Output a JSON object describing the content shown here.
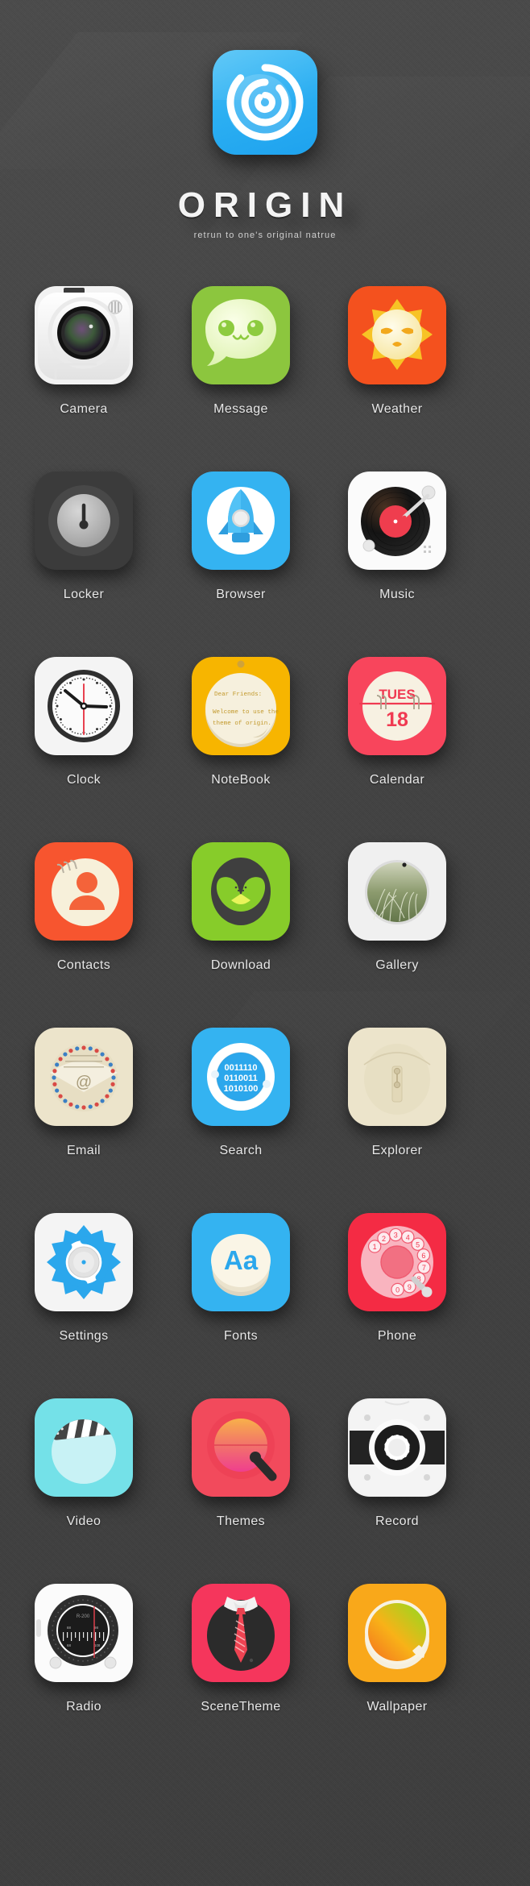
{
  "header": {
    "logo_icon": "origin-spiral-icon",
    "title": "ORIGIN",
    "tagline": "retrun to one's original natrue",
    "brand_color": "#2aaef2"
  },
  "grid": {
    "columns": 3,
    "rows": 8,
    "apps": [
      {
        "label": "Camera",
        "icon": "camera-icon",
        "bg": "#f2f2f2",
        "row": 0,
        "col": 0
      },
      {
        "label": "Message",
        "icon": "message-icon",
        "bg": "#8cc63e",
        "row": 0,
        "col": 1
      },
      {
        "label": "Weather",
        "icon": "weather-sun-icon",
        "bg": "#f4511e",
        "row": 0,
        "col": 2
      },
      {
        "label": "Locker",
        "icon": "locker-icon",
        "bg": "#3b3b3b",
        "row": 1,
        "col": 0
      },
      {
        "label": "Browser",
        "icon": "rocket-icon",
        "bg": "#34b3f1",
        "row": 1,
        "col": 1
      },
      {
        "label": "Music",
        "icon": "turntable-icon",
        "bg": "#fafafa",
        "row": 1,
        "col": 2
      },
      {
        "label": "Clock",
        "icon": "clock-icon",
        "bg": "#f4f4f4",
        "row": 2,
        "col": 0
      },
      {
        "label": "NoteBook",
        "icon": "notebook-icon",
        "bg": "#f7b500",
        "row": 2,
        "col": 1
      },
      {
        "label": "Calendar",
        "icon": "calendar-icon",
        "bg": "#f8455c",
        "row": 2,
        "col": 2
      },
      {
        "label": "Contacts",
        "icon": "contacts-icon",
        "bg": "#f7552f",
        "row": 3,
        "col": 0
      },
      {
        "label": "Download",
        "icon": "download-icon",
        "bg": "#87cc2a",
        "row": 3,
        "col": 1
      },
      {
        "label": "Gallery",
        "icon": "gallery-icon",
        "bg": "#f0f0f0",
        "row": 3,
        "col": 2
      },
      {
        "label": "Email",
        "icon": "airmail-icon",
        "bg": "#ece4cb",
        "row": 4,
        "col": 0
      },
      {
        "label": "Search",
        "icon": "search-icon",
        "bg": "#34b3f1",
        "row": 4,
        "col": 1
      },
      {
        "label": "Explorer",
        "icon": "folder-icon",
        "bg": "#ece4cb",
        "row": 4,
        "col": 2
      },
      {
        "label": "Settings",
        "icon": "gear-icon",
        "bg": "#f4f4f4",
        "row": 5,
        "col": 0
      },
      {
        "label": "Fonts",
        "icon": "fonts-icon",
        "bg": "#34b3f1",
        "row": 5,
        "col": 1
      },
      {
        "label": "Phone",
        "icon": "rotary-dial-icon",
        "bg": "#f42b44",
        "row": 5,
        "col": 2
      },
      {
        "label": "Video",
        "icon": "clapperboard-icon",
        "bg": "#74e1e8",
        "row": 6,
        "col": 0
      },
      {
        "label": "Themes",
        "icon": "themes-icon",
        "bg": "#f24a5c",
        "row": 6,
        "col": 1
      },
      {
        "label": "Record",
        "icon": "cassette-icon",
        "bg": "#f2f2f2",
        "row": 6,
        "col": 2
      },
      {
        "label": "Radio",
        "icon": "radio-icon",
        "bg": "#fbfbfb",
        "row": 7,
        "col": 0
      },
      {
        "label": "SceneTheme",
        "icon": "suit-tie-icon",
        "bg": "#f5365c",
        "row": 7,
        "col": 1
      },
      {
        "label": "Wallpaper",
        "icon": "wallpaper-icon",
        "bg": "#f9a81a",
        "row": 7,
        "col": 2
      }
    ]
  },
  "icon_text": {
    "notebook_line1": "Dear Friends:",
    "notebook_line2": "Welcome to use the",
    "notebook_line3": "theme of origin.",
    "calendar_weekday": "TUES",
    "calendar_day": "18",
    "search_binary_1": "0011110",
    "search_binary_2": "0110011",
    "search_binary_3": "1010100",
    "fonts_sample": "Aa",
    "email_at": "@",
    "phone_digits": [
      "1",
      "2",
      "3",
      "4",
      "5",
      "6",
      "7",
      "8",
      "9",
      "0"
    ],
    "radio_model": "R-200"
  }
}
